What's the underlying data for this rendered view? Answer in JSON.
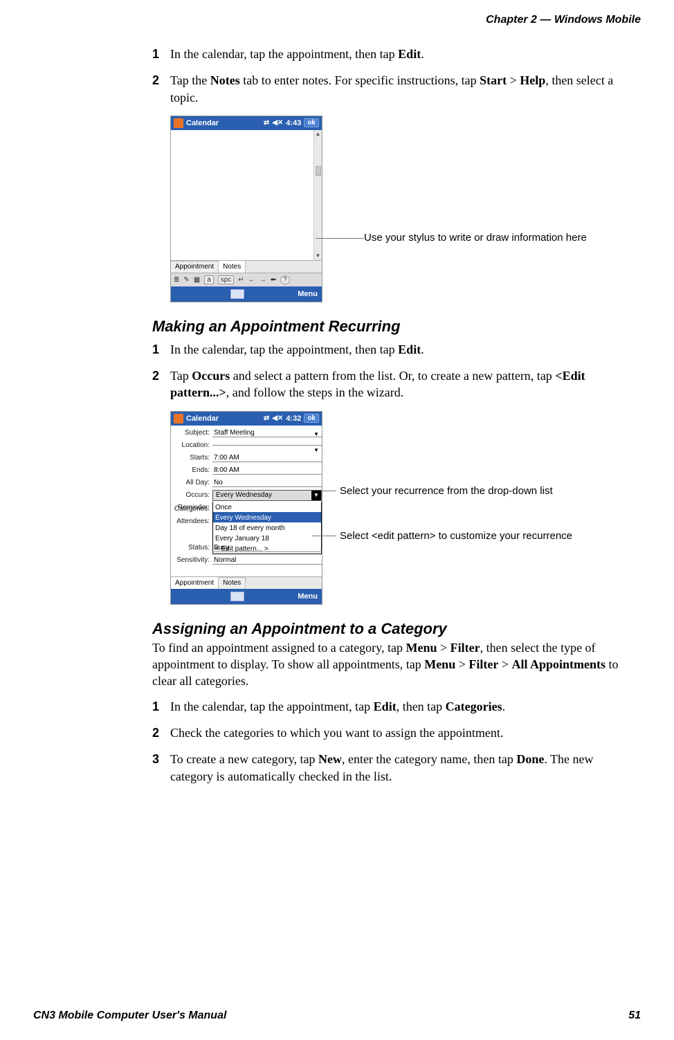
{
  "header": {
    "chapter_label": "Chapter 2 —  Windows Mobile"
  },
  "intro_steps": [
    {
      "num": "1",
      "parts": [
        "In the calendar, tap the appointment, then tap ",
        "Edit",
        "."
      ]
    },
    {
      "num": "2",
      "parts": [
        "Tap the ",
        "Notes",
        " tab to enter notes. For specific instructions, tap ",
        "Start",
        " > ",
        "Help",
        ", then select a topic."
      ]
    }
  ],
  "screenshot1": {
    "title": "Calendar",
    "time": "4:43",
    "ok": "ok",
    "tabs": [
      "Appointment",
      "Notes"
    ],
    "active_tab": 1,
    "sip": {
      "a": "a",
      "spc": "spc",
      "help": "?"
    },
    "menu": "Menu"
  },
  "callout1": "Use your stylus to write or draw information here",
  "heading_recurring": "Making an Appointment Recurring",
  "recurring_steps": [
    {
      "num": "1",
      "parts": [
        "In the calendar, tap the appointment, then tap ",
        "Edit",
        "."
      ]
    },
    {
      "num": "2",
      "parts": [
        "Tap ",
        "Occurs",
        " and select a pattern from the list. Or, to create a new pattern, tap ",
        "<Edit pattern...>",
        ", and follow the steps in the wizard."
      ]
    }
  ],
  "screenshot2": {
    "title": "Calendar",
    "time": "4:32",
    "ok": "ok",
    "fields": {
      "Subject": "Staff Meeting",
      "Location": "",
      "Starts": "7:00 AM",
      "Ends": "8:00 AM",
      "AllDay": "No",
      "Occurs": "Every Wednesday",
      "Reminder": "",
      "Categories": "",
      "Attendees": "",
      "Status": "Busy",
      "Sensitivity": "Normal"
    },
    "field_labels": {
      "Subject": "Subject:",
      "Location": "Location:",
      "Starts": "Starts:",
      "Ends": "Ends:",
      "AllDay": "All Day:",
      "Occurs": "Occurs:",
      "Reminder": "Reminder:",
      "Categories": "Categories:",
      "Attendees": "Attendees:",
      "Status": "Status:",
      "Sensitivity": "Sensitivity:"
    },
    "occurs_options": [
      "Once",
      "Every Wednesday",
      "Day 18 of every month",
      "Every January 18",
      "< Edit pattern... >"
    ],
    "occurs_selected_index": 1,
    "tabs": [
      "Appointment",
      "Notes"
    ],
    "active_tab": 0,
    "menu": "Menu"
  },
  "callout2a": "Select your recurrence from the drop-down list",
  "callout2b": "Select <edit pattern> to customize your recurrence",
  "heading_category": "Assigning an Appointment to a Category",
  "category_para_parts": [
    "To find an appointment assigned to a category, tap ",
    "Menu",
    " > ",
    "Filter",
    ", then select the type of appointment to display. To show all appointments, tap ",
    "Menu",
    " > ",
    "Filter",
    " > ",
    "All Appointments",
    " to clear all categories."
  ],
  "category_steps": [
    {
      "num": "1",
      "parts": [
        "In the calendar, tap the appointment, tap ",
        "Edit",
        ", then tap ",
        "Categories",
        "."
      ]
    },
    {
      "num": "2",
      "parts": [
        "Check the categories to which you want to assign the appointment."
      ]
    },
    {
      "num": "3",
      "parts": [
        "To create a new category, tap ",
        "New",
        ", enter the category name, then tap ",
        "Done",
        ". The new category is automatically checked in the list."
      ]
    }
  ],
  "footer": {
    "manual_title": "CN3 Mobile Computer User's Manual",
    "page_number": "51"
  }
}
